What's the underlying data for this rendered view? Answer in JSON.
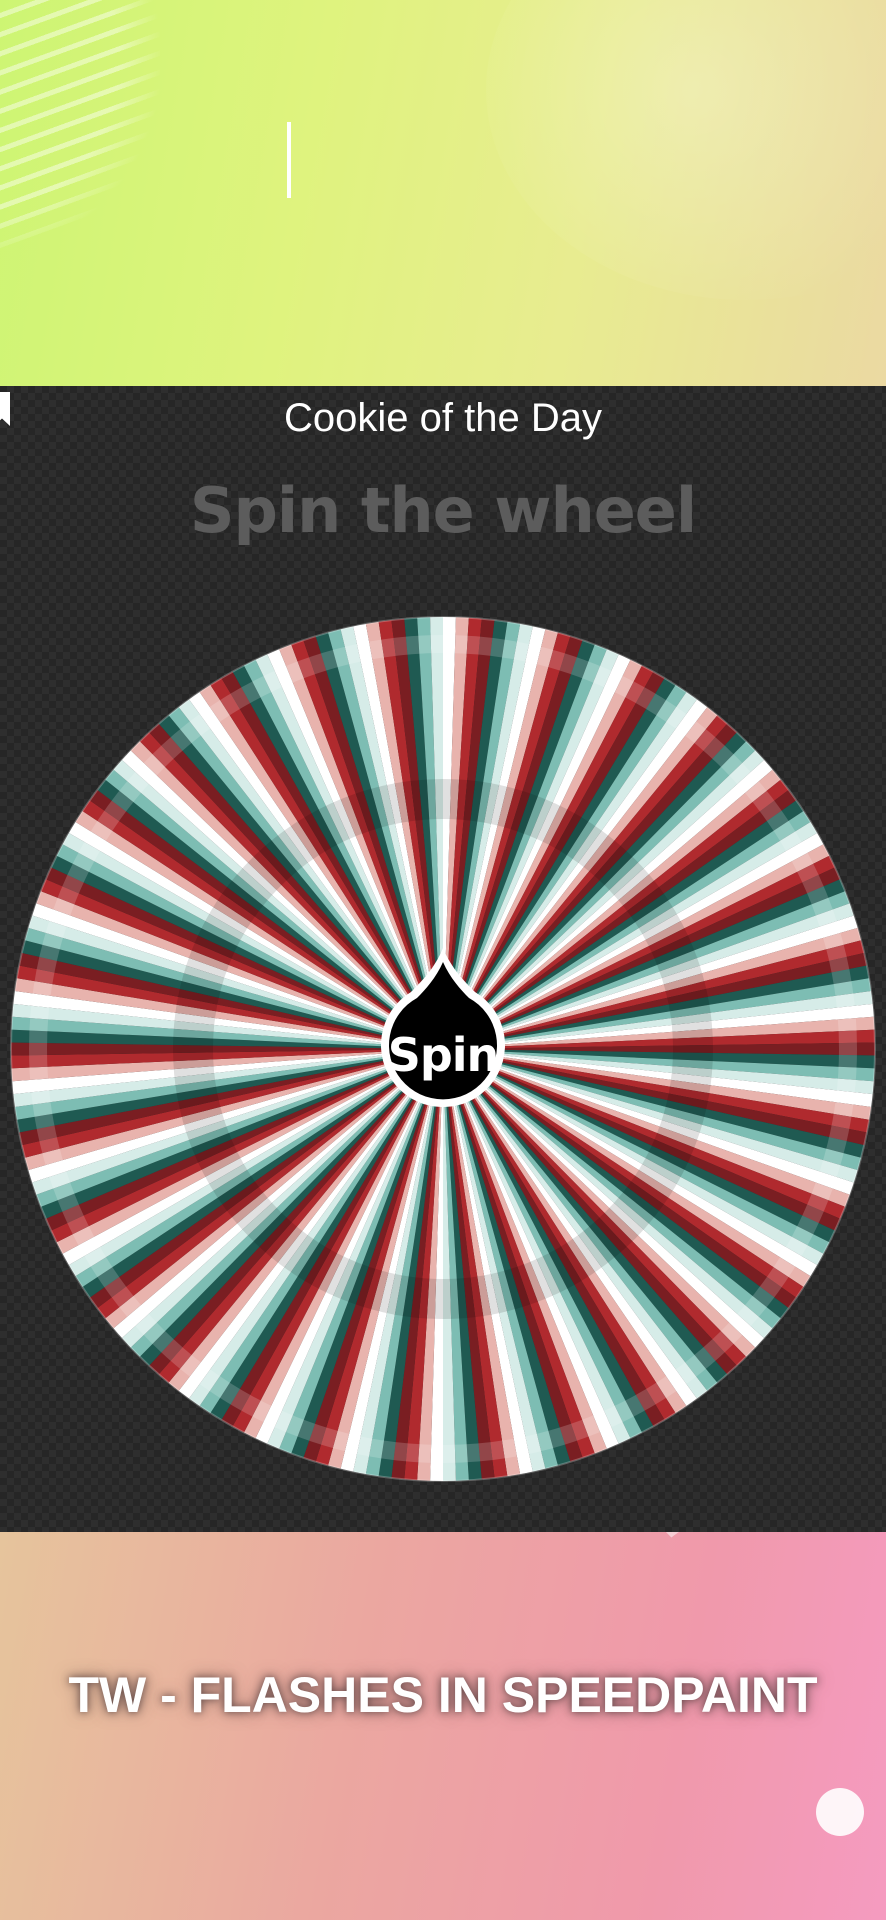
{
  "top_area": {
    "text_cursor_visible": true
  },
  "wheel_panel": {
    "title": "Cookie of the Day",
    "subtitle": "Spin the wheel",
    "spin_label": "Spin",
    "segment_colors": [
      "#ffffff",
      "#e8b3ad",
      "#b02a2e",
      "#7a1e22",
      "#1f5a52",
      "#7dbdb3",
      "#d6ece8"
    ]
  },
  "bottom_area": {
    "caption": "TW - FLASHES IN SPEEDPAINT"
  }
}
